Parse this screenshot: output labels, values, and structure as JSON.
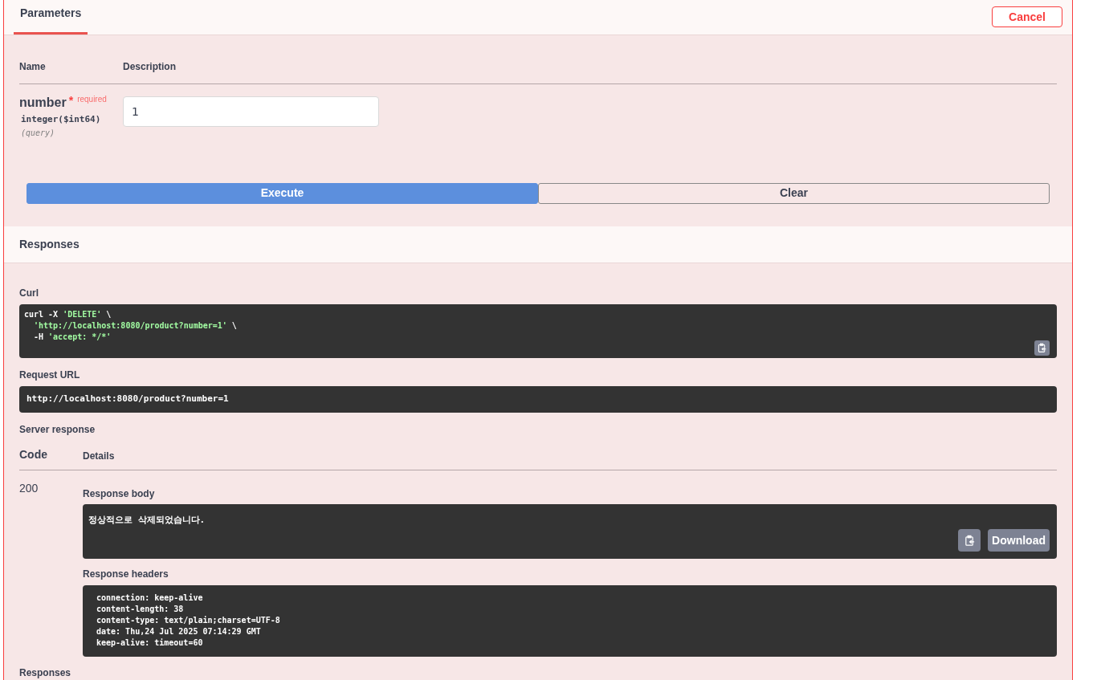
{
  "header": {
    "tabs": [
      {
        "label": "Parameters",
        "selected": true
      }
    ],
    "cancel_button": "Cancel"
  },
  "parameters": {
    "columns": [
      "Name",
      "Description"
    ],
    "rows": [
      {
        "name": "number",
        "required_mark": "*",
        "required_label": "required",
        "type": "integer($int64)",
        "location": "(query)",
        "value": "1"
      }
    ]
  },
  "actions": [
    {
      "label": "Execute",
      "kind": "primary"
    },
    {
      "label": "Clear",
      "kind": "secondary"
    }
  ],
  "responses": {
    "title": "Responses",
    "curl": {
      "label": "Curl",
      "lines": [
        {
          "indented": false,
          "parts": [
            {
              "text": "curl -X ",
              "kind": "plain"
            },
            {
              "text": "'DELETE'",
              "kind": "string"
            },
            {
              "text": " \\",
              "kind": "plain"
            }
          ]
        },
        {
          "indented": true,
          "parts": [
            {
              "text": "'http://localhost:8080/product?number=1'",
              "kind": "string"
            },
            {
              "text": " \\",
              "kind": "plain"
            }
          ]
        },
        {
          "indented": true,
          "parts": [
            {
              "text": "-H ",
              "kind": "plain"
            },
            {
              "text": "'accept: */*'",
              "kind": "string"
            }
          ]
        }
      ]
    },
    "request_url": {
      "label": "Request URL",
      "value": "http://localhost:8080/product?number=1"
    },
    "server_response": {
      "label": "Server response",
      "columns": [
        "Code",
        "Details"
      ],
      "code": "200",
      "body_label": "Response body",
      "body": "정상적으로 삭제되었습니다.",
      "download_button": "Download",
      "headers_label": "Response headers",
      "headers": [
        "connection: keep-alive",
        "content-length: 38",
        "content-type: text/plain;charset=UTF-8",
        "date: Thu,24 Jul 2025 07:14:29 GMT",
        "keep-alive: timeout=60"
      ]
    },
    "footer_title": "Responses"
  }
}
